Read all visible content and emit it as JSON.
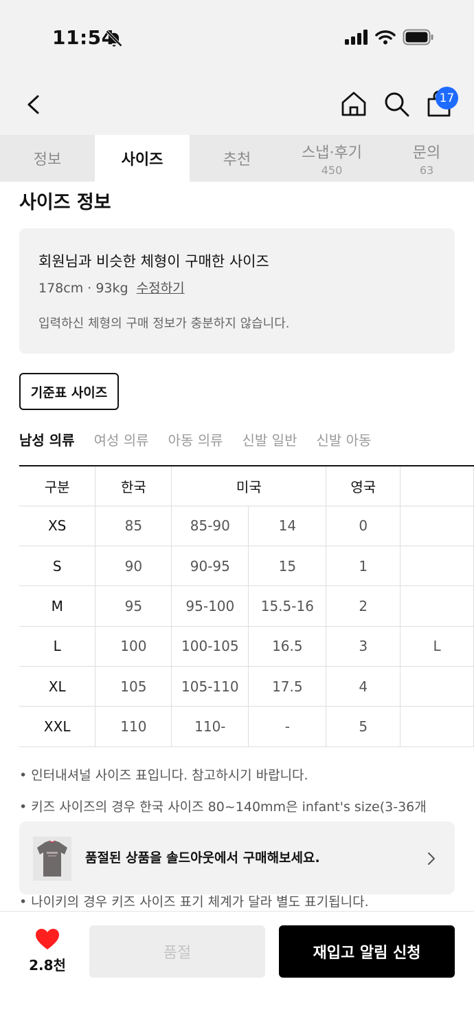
{
  "status_bar": {
    "time": "11:54"
  },
  "nav": {
    "cart_count": "17"
  },
  "tabs": [
    {
      "label": "정보",
      "count": ""
    },
    {
      "label": "사이즈",
      "count": ""
    },
    {
      "label": "추천",
      "count": ""
    },
    {
      "label": "스냅·후기",
      "count": "450"
    },
    {
      "label": "문의",
      "count": "63"
    }
  ],
  "active_tab": "사이즈",
  "size_info": {
    "title": "사이즈 정보",
    "heading": "회원님과 비슷한 체형이 구매한 사이즈",
    "body_stats": "178cm · 93kg",
    "edit_link": "수정하기",
    "note": "입력하신 체형의 구매 정보가 충분하지 않습니다."
  },
  "standard_button": "기준표 사이즈",
  "categories": [
    "남성 의류",
    "여성 의류",
    "아동 의류",
    "신발 일반",
    "신발 아동"
  ],
  "active_category": "남성 의류",
  "size_table": {
    "headers": {
      "col0": "구분",
      "col1": "한국",
      "col2": "미국",
      "col3": "영국"
    },
    "rows": [
      {
        "label": "XS",
        "kr": "85",
        "us1": "85-90",
        "us2": "14",
        "uk": "0",
        "extra": ""
      },
      {
        "label": "S",
        "kr": "90",
        "us1": "90-95",
        "us2": "15",
        "uk": "1",
        "extra": ""
      },
      {
        "label": "M",
        "kr": "95",
        "us1": "95-100",
        "us2": "15.5-16",
        "uk": "2",
        "extra": ""
      },
      {
        "label": "L",
        "kr": "100",
        "us1": "100-105",
        "us2": "16.5",
        "uk": "3",
        "extra": "L"
      },
      {
        "label": "XL",
        "kr": "105",
        "us1": "105-110",
        "us2": "17.5",
        "uk": "4",
        "extra": ""
      },
      {
        "label": "XXL",
        "kr": "110",
        "us1": "110-",
        "us2": "-",
        "uk": "5",
        "extra": ""
      }
    ]
  },
  "notes": {
    "n1": "• 인터내셔널 사이즈 표입니다. 참고하시기 바랍니다.",
    "n2": "• 키즈 사이즈의 경우 한국 사이즈 80~140mm은 infant's size(3-36개",
    "n3": "• 나이키의 경우 키즈 사이즈 표기 체계가 달라 별도 표기됩니다."
  },
  "soldout_banner": {
    "text": "품절된 상품을 솔드아웃에서 구매해보세요."
  },
  "bottom": {
    "like_count": "2.8천",
    "soldout_label": "품절",
    "restock_label": "재입고 알림 신청"
  },
  "colors": {
    "accent": "#1e6bff",
    "heart": "#ff1f1f",
    "primary_button": "#000000"
  }
}
